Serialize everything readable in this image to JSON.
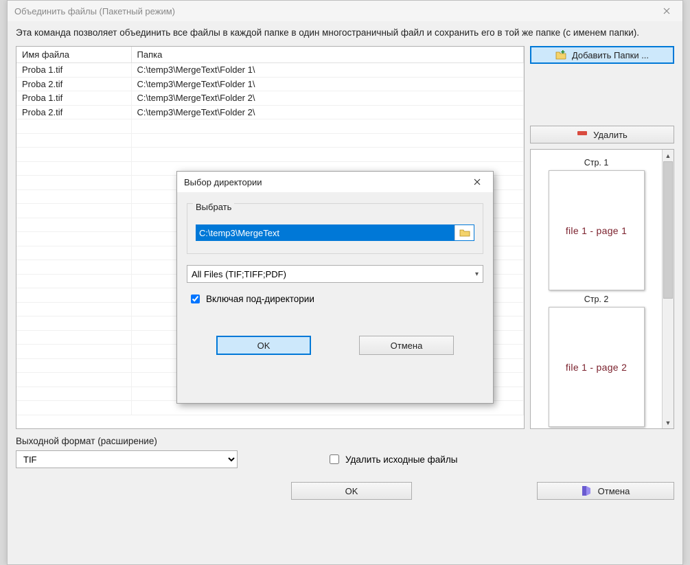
{
  "window": {
    "title": "Объединить файлы (Пакетный режим)",
    "description": "Эта команда позволяет объединить все файлы в каждой папке в один многостраничный файл и сохранить его в той же папке (с именем папки)."
  },
  "table": {
    "headers": {
      "name": "Имя файла",
      "folder": "Папка"
    },
    "rows": [
      {
        "name": "Proba 1.tif",
        "folder": "C:\\temp3\\MergeText\\Folder 1\\"
      },
      {
        "name": "Proba 2.tif",
        "folder": "C:\\temp3\\MergeText\\Folder 1\\"
      },
      {
        "name": "Proba 1.tif",
        "folder": "C:\\temp3\\MergeText\\Folder 2\\"
      },
      {
        "name": "Proba 2.tif",
        "folder": "C:\\temp3\\MergeText\\Folder 2\\"
      }
    ]
  },
  "side": {
    "add_folders": "Добавить Папки ...",
    "delete": "Удалить"
  },
  "preview": {
    "pages": [
      {
        "label": "Стр. 1",
        "content": "file 1 - page 1"
      },
      {
        "label": "Стр. 2",
        "content": "file 1 - page 2"
      }
    ]
  },
  "output": {
    "label": "Выходной формат (расширение)",
    "value": "TIF",
    "delete_sources": "Удалить исходные файлы",
    "ok": "OK",
    "cancel": "Отмена"
  },
  "dialog": {
    "title": "Выбор директории",
    "group_label": "Выбрать",
    "path": "C:\\temp3\\MergeText",
    "filter": "All Files (TIF;TIFF;PDF)",
    "include_subdirs": "Включая под-директории",
    "include_subdirs_checked": true,
    "ok": "OK",
    "cancel": "Отмена"
  }
}
